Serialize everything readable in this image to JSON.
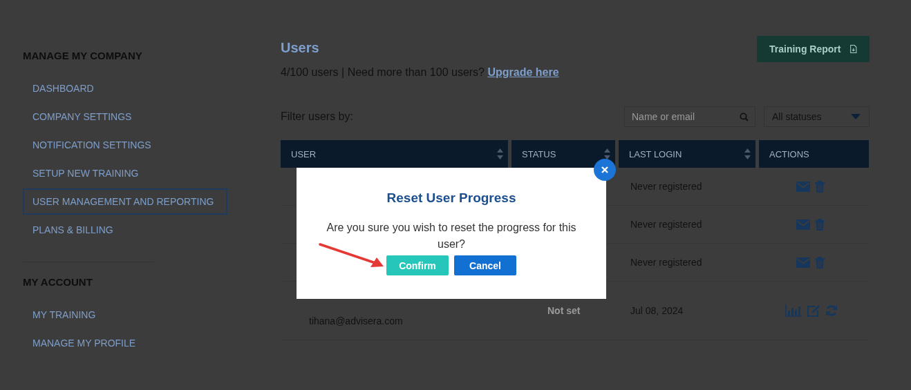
{
  "sidebar": {
    "sections": [
      {
        "heading": "MANAGE MY COMPANY",
        "items": [
          {
            "label": "DASHBOARD",
            "selected": false
          },
          {
            "label": "COMPANY SETTINGS",
            "selected": false
          },
          {
            "label": "NOTIFICATION SETTINGS",
            "selected": false
          },
          {
            "label": "SETUP NEW TRAINING",
            "selected": false
          },
          {
            "label": "USER MANAGEMENT AND REPORTING",
            "selected": true
          },
          {
            "label": "PLANS & BILLING",
            "selected": false
          }
        ]
      },
      {
        "heading": "MY ACCOUNT",
        "items": [
          {
            "label": "MY TRAINING",
            "selected": false
          },
          {
            "label": "MANAGE MY PROFILE",
            "selected": false
          }
        ]
      }
    ]
  },
  "main": {
    "title": "Users",
    "summary": "4/100 users | Need more than 100 users?",
    "upgrade_link": "Upgrade here",
    "report_button": "Training Report",
    "filter_label": "Filter users by:",
    "search": {
      "placeholder": "Name or email"
    },
    "status_filter": {
      "value": "All statuses"
    }
  },
  "table": {
    "columns": [
      {
        "label": "USER",
        "sortable": true
      },
      {
        "label": "STATUS",
        "sortable": true
      },
      {
        "label": "LAST LOGIN",
        "sortable": true
      },
      {
        "label": "ACTIONS",
        "sortable": false
      }
    ],
    "rows": [
      {
        "kind": "invited",
        "last_login": "Never registered"
      },
      {
        "kind": "invited",
        "last_login": "Never registered"
      },
      {
        "kind": "invited",
        "last_login": "Never registered"
      },
      {
        "kind": "registered",
        "email": "tihana@advisera.com",
        "status": "Not set",
        "last_login": "Jul 08, 2024"
      }
    ]
  },
  "dialog": {
    "title": "Reset User Progress",
    "message": "Are you sure you wish to reset the progress for this user?",
    "buttons": [
      {
        "label": "Confirm",
        "kind": "confirm"
      },
      {
        "label": "Cancel",
        "kind": "cancel"
      }
    ]
  }
}
